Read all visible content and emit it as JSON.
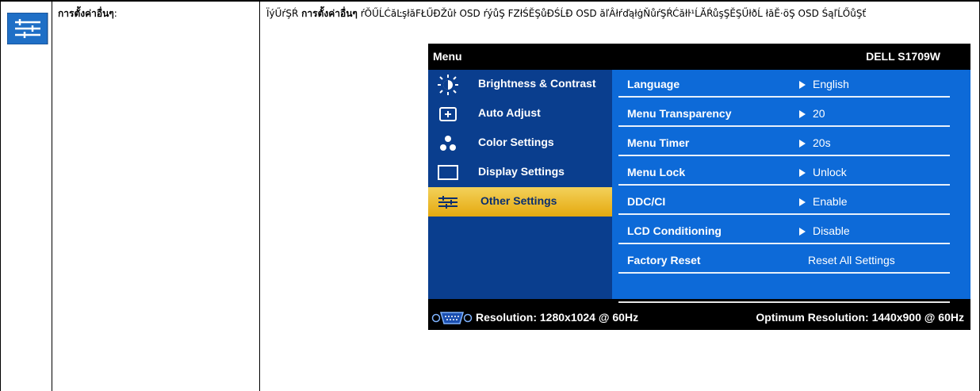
{
  "doc": {
    "heading": "การตั้งค่าอื่นๆ",
    "heading_suffix": ":",
    "description_prefix": "ÏýŰŕŞŔ",
    "description_bold": "การตั้งค่าอื่นๆ",
    "description_rest": "ŕŎŰĹĆăĿşłăFŁŰĐŽûŀ OSD ŕýůŞ FZłŚĔŞůĐŚĹĐ OSD ăľÂłŕďąłġŇůŕŞŔĆăłŀ¹ĹĂŔůşŞĔŞŰłðĹ łăĔ·öŞ OSD ŚąľĹŐůŞť"
  },
  "osd": {
    "menu_title": "Menu",
    "model": "DELL S1709W",
    "left_items": [
      {
        "label": "Brightness & Contrast",
        "icon": "brightness-icon",
        "selected": false
      },
      {
        "label": "Auto Adjust",
        "icon": "auto-adjust-icon",
        "selected": false
      },
      {
        "label": "Color Settings",
        "icon": "color-settings-icon",
        "selected": false
      },
      {
        "label": "Display Settings",
        "icon": "display-settings-icon",
        "selected": false
      },
      {
        "label": "Other Settings",
        "icon": "other-settings-icon",
        "selected": true
      }
    ],
    "right_rows": [
      {
        "key": "Language",
        "value": "English",
        "arrow": true
      },
      {
        "key": "Menu Transparency",
        "value": "20",
        "arrow": true
      },
      {
        "key": "Menu Timer",
        "value": "20s",
        "arrow": true
      },
      {
        "key": "Menu Lock",
        "value": "Unlock",
        "arrow": true
      },
      {
        "key": "DDC/CI",
        "value": "Enable",
        "arrow": true
      },
      {
        "key": "LCD Conditioning",
        "value": "Disable",
        "arrow": true
      },
      {
        "key": "Factory Reset",
        "value": "Reset All Settings",
        "arrow": false
      }
    ],
    "footer_left": "Resolution: 1280x1024 @ 60Hz",
    "footer_right": "Optimum Resolution: 1440x900 @ 60Hz"
  },
  "colors": {
    "left_panel": "#0a3e8e",
    "right_panel": "#0d6ad8",
    "selected": "#e5a90f",
    "doc_icon_bg": "#1f6fc6"
  }
}
